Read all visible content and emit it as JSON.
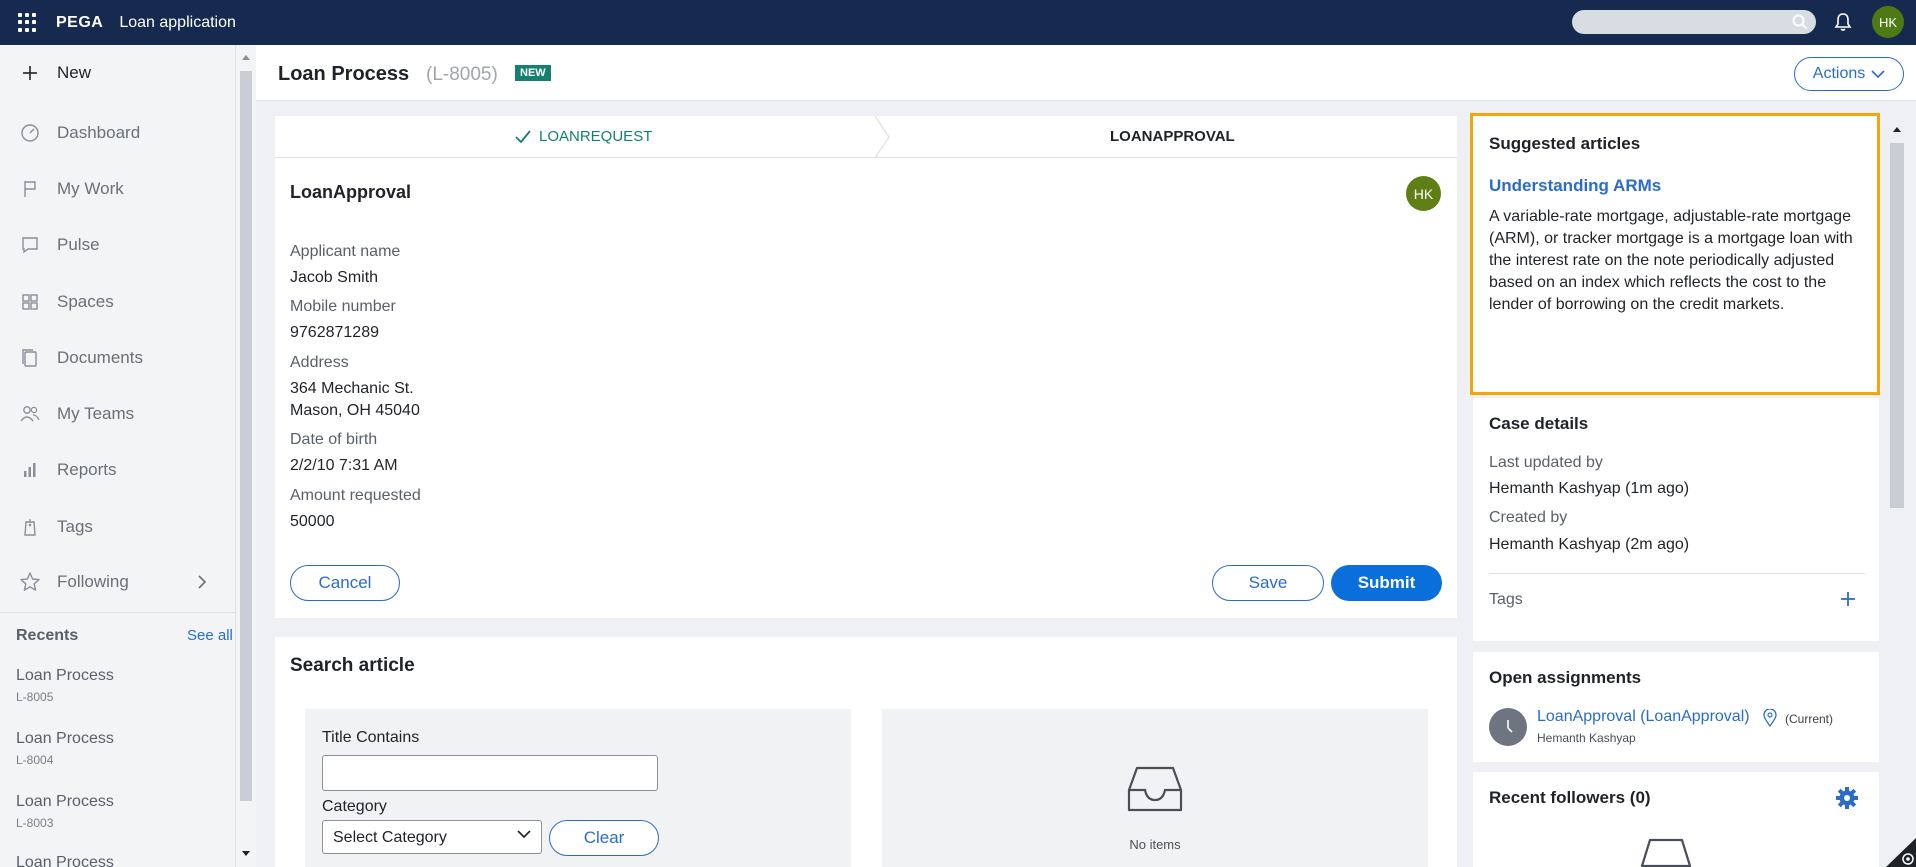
{
  "topbar": {
    "brand": "PEGA",
    "app_title": "Loan application",
    "avatar_initials": "HK",
    "icons": [
      "apps-grid-icon",
      "search-icon",
      "bell-icon"
    ]
  },
  "sidebar": {
    "new_label": "New",
    "items": [
      {
        "label": "Dashboard",
        "icon": "dashboard-icon"
      },
      {
        "label": "My Work",
        "icon": "flag-icon"
      },
      {
        "label": "Pulse",
        "icon": "chat-icon"
      },
      {
        "label": "Spaces",
        "icon": "grid-icon"
      },
      {
        "label": "Documents",
        "icon": "document-icon"
      },
      {
        "label": "My Teams",
        "icon": "people-icon"
      },
      {
        "label": "Reports",
        "icon": "bar-chart-icon"
      },
      {
        "label": "Tags",
        "icon": "tag-icon"
      },
      {
        "label": "Following",
        "icon": "star-icon"
      }
    ],
    "recents_title": "Recents",
    "see_all": "See all",
    "recents": [
      {
        "title": "Loan Process",
        "id": "L-8005"
      },
      {
        "title": "Loan Process",
        "id": "L-8004"
      },
      {
        "title": "Loan Process",
        "id": "L-8003"
      },
      {
        "title": "Loan Process",
        "id": ""
      }
    ]
  },
  "header": {
    "title": "Loan Process",
    "case_id": "(L-8005)",
    "badge": "NEW",
    "actions_label": "Actions"
  },
  "stepper": {
    "step1": "LOANREQUEST",
    "step2": "LOANAPPROVAL"
  },
  "form": {
    "title": "LoanApproval",
    "avatar_initials": "HK",
    "fields": [
      {
        "label": "Applicant name",
        "value": "Jacob Smith"
      },
      {
        "label": "Mobile number",
        "value": "9762871289"
      },
      {
        "label": "Address",
        "value_line1": "364 Mechanic St.",
        "value_line2": "Mason, OH 45040"
      },
      {
        "label": "Date of birth",
        "value": "2/2/10 7:31 AM"
      },
      {
        "label": "Amount requested",
        "value": "50000"
      }
    ],
    "cancel_label": "Cancel",
    "save_label": "Save",
    "submit_label": "Submit"
  },
  "search_article": {
    "title": "Search article",
    "title_contains_label": "Title Contains",
    "title_contains_value": "",
    "category_label": "Category",
    "category_selected": "Select Category",
    "clear_label": "Clear",
    "no_items": "No items"
  },
  "suggested": {
    "title": "Suggested articles",
    "article_title": "Understanding ARMs",
    "article_text": "A variable-rate mortgage, adjustable-rate mortgage (ARM), or tracker mortgage is a mortgage loan with the interest rate on the note periodically adjusted based on an index which reflects the cost to the lender of borrowing on the credit markets."
  },
  "case_details": {
    "title": "Case details",
    "last_updated_label": "Last updated by",
    "last_updated_value": "Hemanth Kashyap (1m ago)",
    "created_label": "Created by",
    "created_value": "Hemanth Kashyap (2m ago)",
    "tags_label": "Tags"
  },
  "assignments": {
    "title": "Open assignments",
    "link": "LoanApproval (LoanApproval)",
    "current": "(Current)",
    "user": "Hemanth Kashyap"
  },
  "followers": {
    "title": "Recent followers",
    "count": "(0)"
  },
  "colors": {
    "topbar_bg": "#152a4e",
    "accent_blue": "#2a6dc9",
    "primary_button": "#0a6fdb",
    "highlight_border": "#f2a60e",
    "badge_green": "#14806f"
  }
}
